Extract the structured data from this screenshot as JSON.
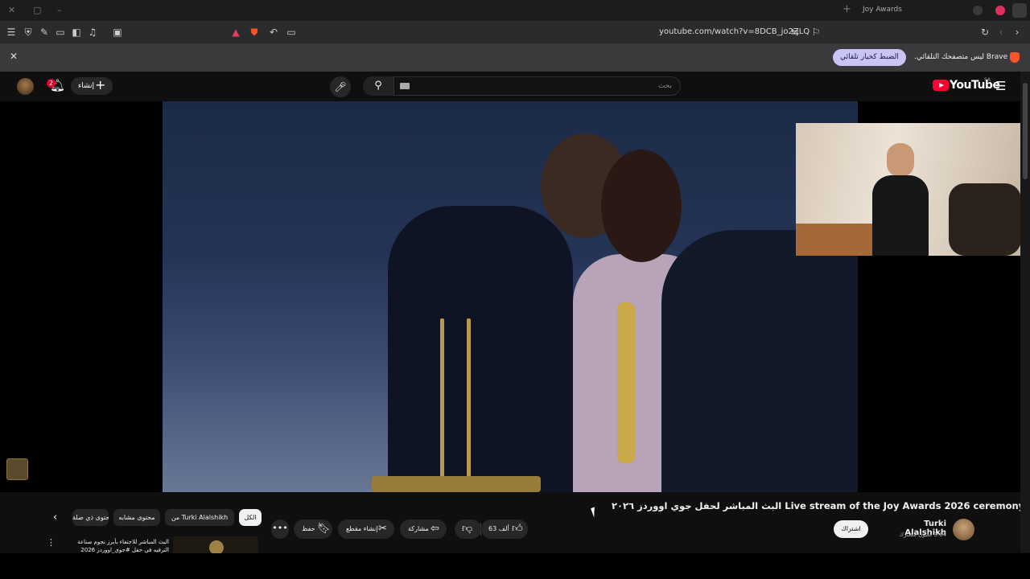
{
  "browser": {
    "tab_title": "Joy Awards",
    "url": "youtube.com/watch?v=8DCB_jo2ZLQ",
    "infobar_message": "Brave ليس متصفحك التلقائي.",
    "infobar_button": "الضبط كخيار تلقائي",
    "colors": {
      "accent": "#c8c4f4",
      "brave": "#fb542b",
      "record": "#e03060"
    }
  },
  "header": {
    "notification_count": "2",
    "create_label": "إنشاء",
    "search_placeholder": "بحث",
    "logo_text": "YouTube",
    "region": "SA"
  },
  "video": {
    "title": "البث المباشر لحفل جوي اووردز ٢٠٢٦ Live stream of the Joy Awards 2026 ceremony",
    "channel_name": "Turki Alalshikh",
    "subscribers": "3.64 مليون مشترك",
    "subscribe_label": "اشتراك",
    "like_count": "63 ألف",
    "share_label": "مشاركة",
    "clip_label": "إنشاء مقطع",
    "save_label": "حفظ",
    "more_label": "•••"
  },
  "chips": [
    {
      "label": "الكل",
      "active": true
    },
    {
      "label": "من Turki Alalshikh",
      "active": false
    },
    {
      "label": "محتوى مشابه",
      "active": false
    },
    {
      "label": "محتوى ذي صلة",
      "active": false
    }
  ],
  "recommendation": {
    "title": "البث المباشر للاحتفاء بأبرز نجوم صناعة الترفيه في حفل #جوي_اووردز 2026"
  },
  "icons": {
    "menu": "menu-icon",
    "shield": "shield-icon",
    "mic": "mic-icon",
    "search": "search-icon",
    "bell": "bell-icon",
    "like": "thumbs-up-icon",
    "dislike": "thumbs-down-icon",
    "share": "share-icon",
    "clip": "scissors-icon",
    "save": "bookmark-icon"
  }
}
